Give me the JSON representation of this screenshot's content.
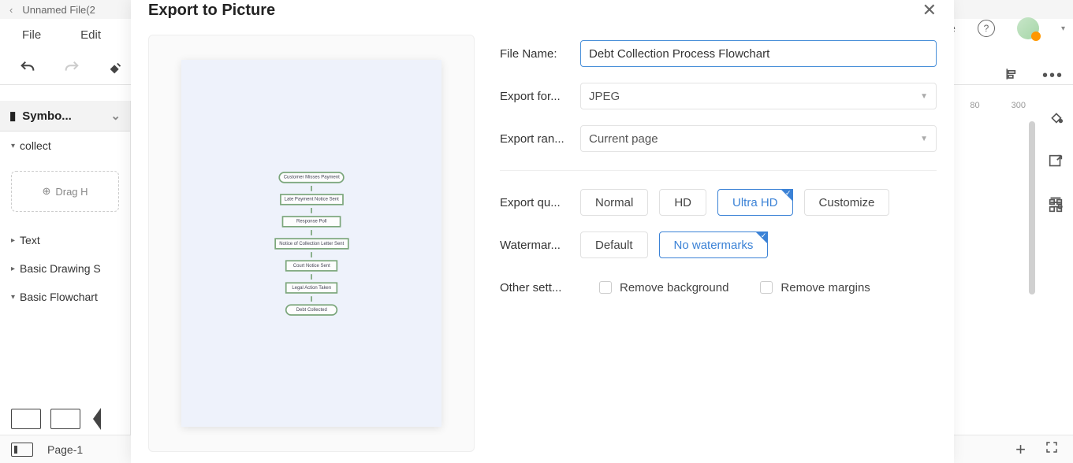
{
  "window": {
    "filename": "Unnamed File(2"
  },
  "menu": {
    "file": "File",
    "edit": "Edit"
  },
  "ruler": {
    "t1": "80",
    "t2": "300"
  },
  "leftpanel": {
    "title": "Symbo...",
    "sec_collect": "collect",
    "dragbox": "Drag H",
    "sec_text": "Text",
    "sec_basic_drawing": "Basic Drawing S",
    "sec_basic_flow": "Basic Flowchart"
  },
  "bottom": {
    "page": "Page-1"
  },
  "dialog": {
    "title": "Export to Picture",
    "filename_label": "File Name:",
    "filename_value": "Debt Collection Process Flowchart",
    "format_label": "Export for...",
    "format_value": "JPEG",
    "range_label": "Export ran...",
    "range_value": "Current page",
    "quality_label": "Export qu...",
    "quality_normal": "Normal",
    "quality_hd": "HD",
    "quality_ultra": "Ultra HD",
    "quality_custom": "Customize",
    "watermark_label": "Watermar...",
    "watermark_default": "Default",
    "watermark_none": "No watermarks",
    "other_label": "Other sett...",
    "remove_bg": "Remove background",
    "remove_margins": "Remove margins"
  },
  "preview": {
    "n1": "Customer Misses Payment",
    "n2": "Late Payment Notice Sent",
    "n3": "Response Poll",
    "n4": "Notice of Collection Letter Sent",
    "n5": "Court Notice Sent",
    "n6": "Legal Action Taken",
    "n7": "Debt Collected"
  }
}
